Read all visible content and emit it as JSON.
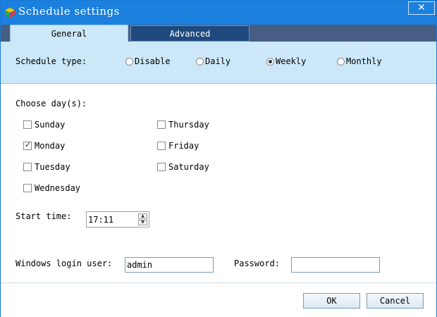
{
  "window": {
    "title": "Schedule settings",
    "close_glyph": "✕",
    "icon": "app-cube-icon"
  },
  "tabs": [
    {
      "label": "General",
      "active": true
    },
    {
      "label": "Advanced",
      "active": false
    }
  ],
  "schedule_type": {
    "label": "Schedule type:",
    "options": [
      {
        "label": "Disable",
        "checked": false
      },
      {
        "label": "Daily",
        "checked": false
      },
      {
        "label": "Weekly",
        "checked": true
      },
      {
        "label": "Monthly",
        "checked": false
      }
    ]
  },
  "days": {
    "label": "Choose day(s):",
    "items": [
      {
        "label": "Sunday",
        "checked": false
      },
      {
        "label": "Monday",
        "checked": true
      },
      {
        "label": "Tuesday",
        "checked": false
      },
      {
        "label": "Wednesday",
        "checked": false
      },
      {
        "label": "Thursday",
        "checked": false
      },
      {
        "label": "Friday",
        "checked": false
      },
      {
        "label": "Saturday",
        "checked": false
      }
    ],
    "check_glyph": "✓"
  },
  "start_time": {
    "label": "Start time:",
    "value": "17:11",
    "up_glyph": "▲",
    "down_glyph": "▼"
  },
  "login": {
    "user_label": "Windows login user:",
    "user_value": "admin",
    "password_label": "Password:",
    "password_value": ""
  },
  "buttons": {
    "ok": "OK",
    "cancel": "Cancel"
  },
  "colors": {
    "titlebar": "#1b80de",
    "tabstrip": "#485d83",
    "panel": "#cce8f8",
    "tab_inactive": "#1f4a7e"
  }
}
